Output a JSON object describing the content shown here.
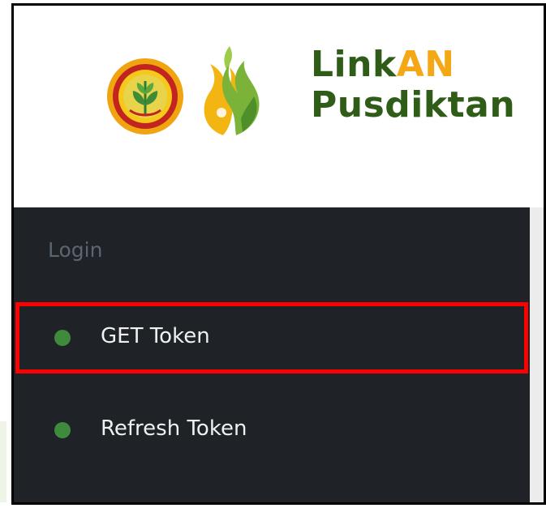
{
  "brand": {
    "name_part1": "Link",
    "name_accent": "AN",
    "name_line2": "Pusdiktan"
  },
  "sidebar": {
    "section_label": "Login",
    "items": [
      {
        "label": "GET Token",
        "icon": "green-dot-icon"
      },
      {
        "label": "Refresh Token",
        "icon": "green-dot-icon"
      }
    ]
  },
  "colors": {
    "brand_green": "#2f5d17",
    "brand_orange": "#f4a815",
    "sidebar_bg": "#1f2226",
    "dot_green": "#3f8a3c",
    "highlight_red": "#ff0000"
  }
}
